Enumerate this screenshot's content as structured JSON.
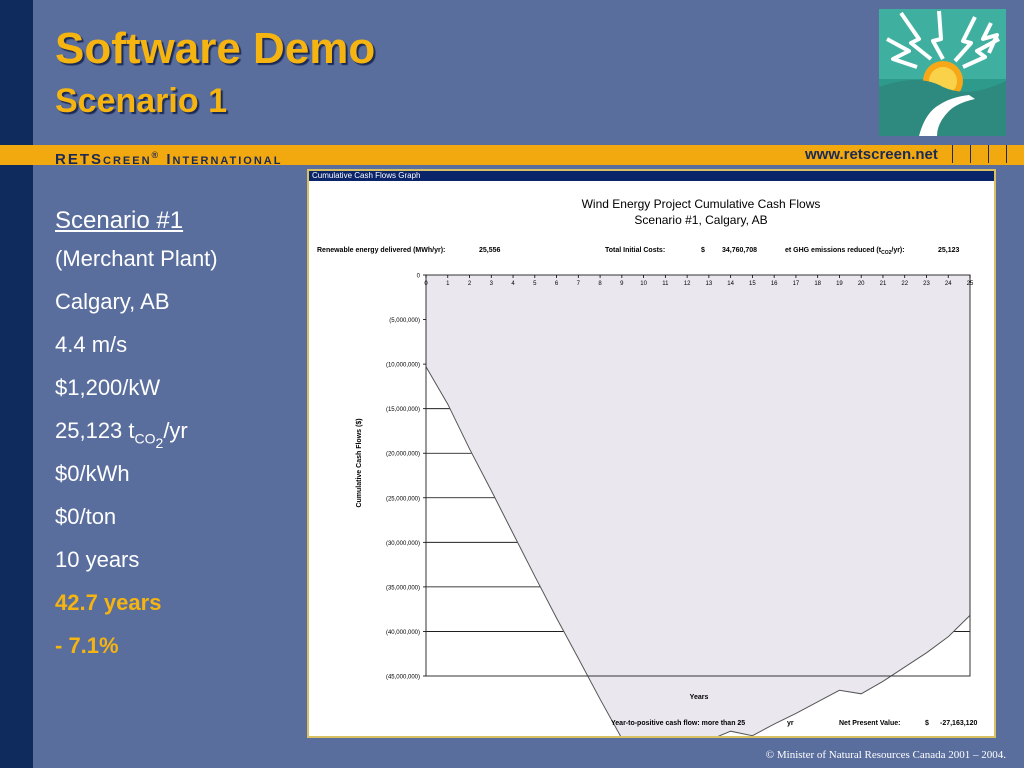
{
  "slide": {
    "title": "Software Demo",
    "subtitle": "Scenario 1",
    "brand_rets": "RETS",
    "brand_creen": "CREEN",
    "brand_reg": "®",
    "brand_i": "I",
    "brand_nternational": "NTERNATIONAL",
    "url": "www.retscreen.net",
    "footer": "© Minister of Natural Resources Canada 2001 – 2004."
  },
  "scenario": {
    "heading": "Scenario #1",
    "plant_type": "(Merchant Plant)",
    "location": "Calgary, AB",
    "wind_speed": "4.4 m/s",
    "cost_per_kw": "$1,200/kW",
    "ghg_value": "25,123 t",
    "ghg_sub_co": "CO",
    "ghg_sub_2": "2",
    "ghg_unit": "/yr",
    "energy_price": "$0/kWh",
    "ghg_credit": "$0/ton",
    "debt_term": "10 years",
    "payback": "42.7 years",
    "irr": "- 7.1%"
  },
  "colors": {
    "accent_yellow": "#f5b40f",
    "background": "#5a6e9e",
    "navy": "#0f2a5c",
    "banner": "#f2a90f",
    "area_fill": "#ebe7ef"
  },
  "icons": {
    "logo": "sun-river-logo-icon"
  },
  "chart_window": {
    "title": "Cumulative Cash Flows Graph"
  },
  "chart_data": {
    "type": "area",
    "title": "Wind Energy Project Cumulative Cash Flows",
    "subtitle": "Scenario #1, Calgary, AB",
    "xlabel": "Years",
    "ylabel": "Cumulative Cash Flows  ($)",
    "x": [
      0,
      1,
      2,
      3,
      4,
      5,
      6,
      7,
      8,
      9,
      10,
      11,
      12,
      13,
      14,
      15,
      16,
      17,
      18,
      19,
      20,
      21,
      22,
      23,
      24,
      25
    ],
    "values": [
      -10300000,
      -14500000,
      -19500000,
      -24200000,
      -29000000,
      -33800000,
      -38500000,
      -43000000,
      -47600000,
      -52000000,
      -55100000,
      -54100000,
      -53100000,
      -52200000,
      -51200000,
      -51700000,
      -50400000,
      -49200000,
      -47900000,
      -46600000,
      -47000000,
      -45600000,
      -44000000,
      -42400000,
      -40600000,
      -38200000
    ],
    "ylim": [
      -45000000,
      0
    ],
    "xlim": [
      0,
      25
    ],
    "y_ticks": [
      0,
      -5000000,
      -10000000,
      -15000000,
      -20000000,
      -25000000,
      -30000000,
      -35000000,
      -40000000,
      -45000000
    ],
    "y_tick_labels": [
      "0",
      "(5,000,000)",
      "(10,000,000)",
      "(15,000,000)",
      "(20,000,000)",
      "(25,000,000)",
      "(30,000,000)",
      "(35,000,000)",
      "(40,000,000)",
      "(45,000,000)"
    ],
    "x_tick_labels": [
      "0",
      "1",
      "2",
      "3",
      "4",
      "5",
      "6",
      "7",
      "8",
      "9",
      "10",
      "11",
      "12",
      "13",
      "14",
      "15",
      "16",
      "17",
      "18",
      "19",
      "20",
      "21",
      "22",
      "23",
      "24",
      "25"
    ],
    "grid": true,
    "header": {
      "energy_label": "Renewable energy delivered (MWh/yr):",
      "energy_value": "25,556",
      "cost_label": "Total Initial Costs:",
      "cost_currency": "$",
      "cost_value": "34,760,708",
      "ghg_label": "et GHG emissions reduced (t",
      "ghg_sub": "CO2",
      "ghg_label_end": "/yr):",
      "ghg_value": "25,123"
    },
    "footer": {
      "payback_label": "Year-to-positive cash flow: more than 25",
      "payback_unit": "yr",
      "npv_label": "Net Present Value:",
      "npv_currency": "$",
      "npv_value": "-27,163,120"
    }
  }
}
